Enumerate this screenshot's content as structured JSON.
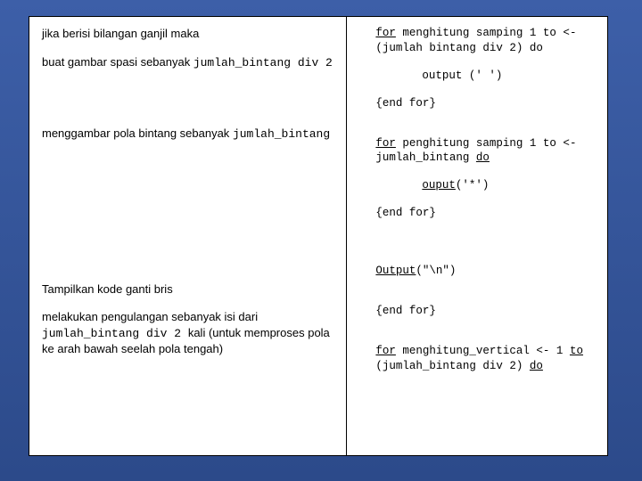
{
  "left": {
    "l1_a": "jika berisi bilangan ganjil maka",
    "l2_a": "buat gambar  spasi  sebanyak ",
    "l2_b": "jumlah_bintang div 2",
    "l3_a": "menggambar pola bintang sebanyak ",
    "l3_b": "jumlah_bintang",
    "l4_a": "Tampilkan kode ganti bris",
    "l5_a": "melakukan pengulangan sebanyak isi dari ",
    "l5_b": "jumlah_bintang div 2 ",
    "l5_c": "kali (untuk memproses pola ke arah bawah seelah pola tengah)"
  },
  "right": {
    "r1_for": "for",
    "r1_rest": " menghitung samping 1 to <-(jumlah bintang div 2) do",
    "r2": "output (' ')",
    "r3_a": "{end ",
    "r3_b": "for",
    "r3_c": "}",
    "r4_for": "for",
    "r4_rest": " penghitung samping 1 to <- jumlah_bintang ",
    "r4_do": "do",
    "r5_a": "ouput",
    "r5_b": "('*')",
    "r6_a": "{end ",
    "r6_b": "for",
    "r6_c": "}",
    "r7_a": "Output",
    "r7_b": "(\"\\n\")",
    "r8_a": "{end ",
    "r8_b": "for",
    "r8_c": "}",
    "r9_for": "for",
    "r9_rest": " menghitung_vertical <- 1 ",
    "r9_to": "to",
    "r9_tail": " (jumlah_bintang div 2) ",
    "r9_do": "do"
  }
}
